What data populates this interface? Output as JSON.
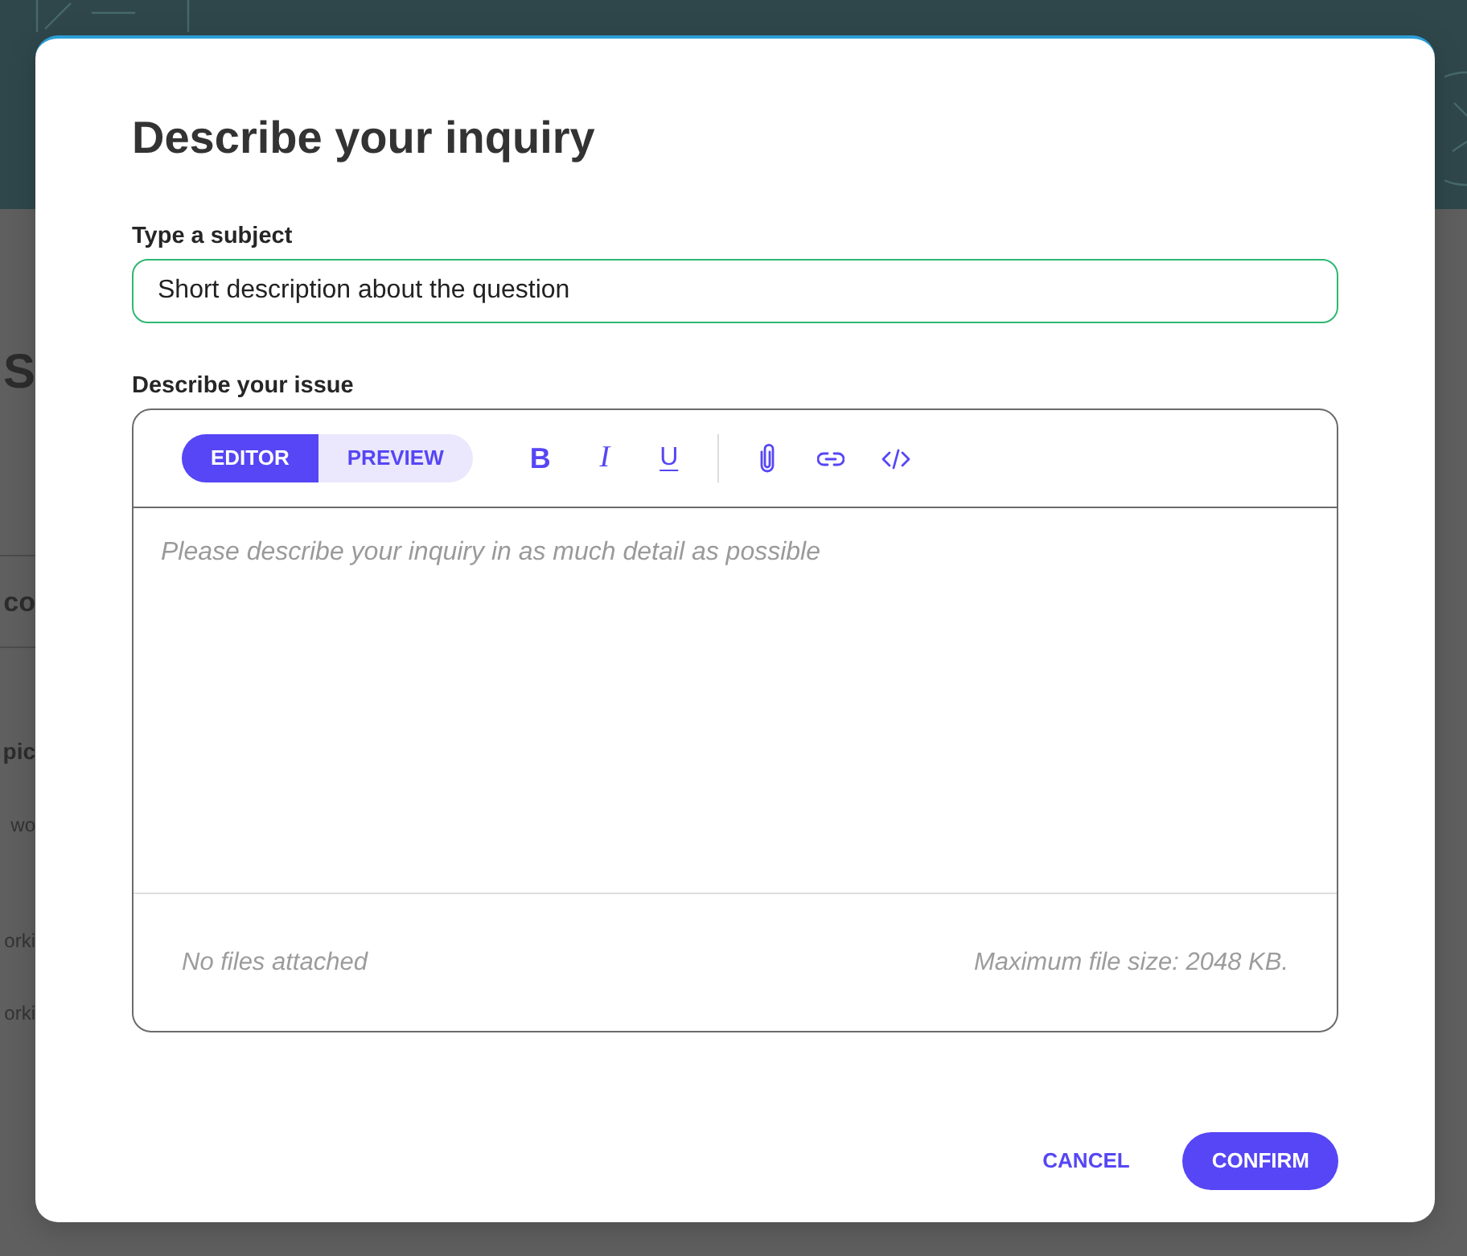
{
  "background_page": {
    "fragments": [
      {
        "kind": "title",
        "text": "S"
      },
      {
        "kind": "section",
        "text": "co"
      },
      {
        "kind": "heading",
        "text": "pic"
      },
      {
        "kind": "line",
        "text": "wo"
      },
      {
        "kind": "line",
        "text": "orki"
      },
      {
        "kind": "line",
        "text": "orki"
      }
    ]
  },
  "dialog": {
    "title": "Describe your inquiry",
    "subject": {
      "label": "Type a subject",
      "value": "Short description about the question",
      "focused": true
    },
    "issue": {
      "label": "Describe your issue",
      "tabs": [
        {
          "label": "EDITOR",
          "selected": true
        },
        {
          "label": "PREVIEW",
          "selected": false
        }
      ],
      "format_buttons": [
        {
          "label": "B",
          "kind": "bold"
        },
        {
          "label": "I",
          "kind": "italic"
        },
        {
          "label": "U",
          "kind": "underline"
        }
      ],
      "insert_buttons": [
        {
          "kind": "attachment"
        },
        {
          "kind": "link"
        },
        {
          "kind": "code"
        }
      ],
      "placeholder": "Please describe your inquiry in as much detail as possible",
      "attachments_status": "No files attached",
      "size_limit": "Maximum file size: 2048 KB."
    },
    "buttons": [
      {
        "label": "CANCEL",
        "kind": "text"
      },
      {
        "label": "CONFIRM",
        "kind": "primary"
      }
    ]
  }
}
